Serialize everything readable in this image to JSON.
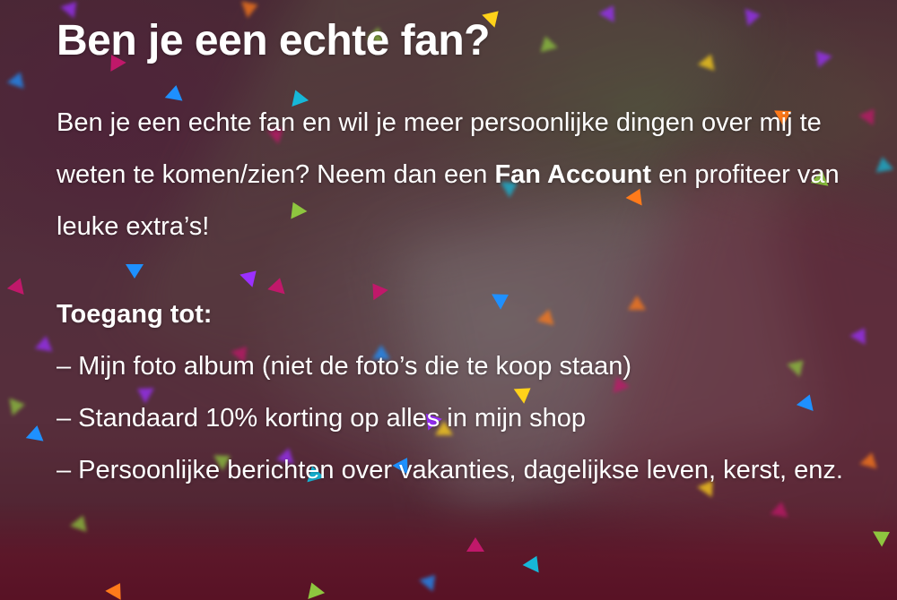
{
  "heading": {
    "title": "Ben je een echte fan?"
  },
  "intro": {
    "text_before": "Ben je een echte fan en wil je meer persoonlijke dingen over mij te weten te komen/zien? Neem dan een ",
    "bold": "Fan Account",
    "text_after": " en profiteer van leuke extra’s!"
  },
  "access": {
    "heading": "Toegang tot:",
    "items": [
      "– Mijn foto album (niet de foto’s die te koop staan)",
      "– Standaard 10% korting op alles in mijn shop",
      "– Persoonlijke berichten over vakanties, dagelijkse leven, kerst, enz."
    ]
  },
  "colors": {
    "text": "#ffffff",
    "confetti": [
      "#1e90ff",
      "#9b30ff",
      "#c0186a",
      "#ff7a1a",
      "#8ec63f",
      "#ffd21a",
      "#16b7d8"
    ]
  }
}
